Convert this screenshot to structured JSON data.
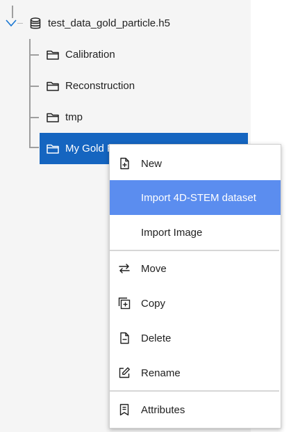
{
  "tree": {
    "root_label": "test_data_gold_particle.h5",
    "children": [
      {
        "label": "Calibration"
      },
      {
        "label": "Reconstruction"
      },
      {
        "label": "tmp"
      },
      {
        "label": "My Gold P"
      }
    ],
    "selected_index": 3,
    "selected_color": "#1565c0"
  },
  "context_menu": {
    "items": [
      {
        "label": "New",
        "icon": "file-plus-icon"
      },
      {
        "label": "Import 4D-STEM dataset",
        "icon": null,
        "highlighted": true
      },
      {
        "label": "Import Image",
        "icon": null
      },
      {
        "label": "Move",
        "icon": "swap-arrows-icon"
      },
      {
        "label": "Copy",
        "icon": "copy-plus-icon"
      },
      {
        "label": "Delete",
        "icon": "file-minus-icon"
      },
      {
        "label": "Rename",
        "icon": "edit-icon"
      },
      {
        "label": "Attributes",
        "icon": "bookmark-list-icon"
      }
    ],
    "highlight_color": "#5b8def"
  }
}
